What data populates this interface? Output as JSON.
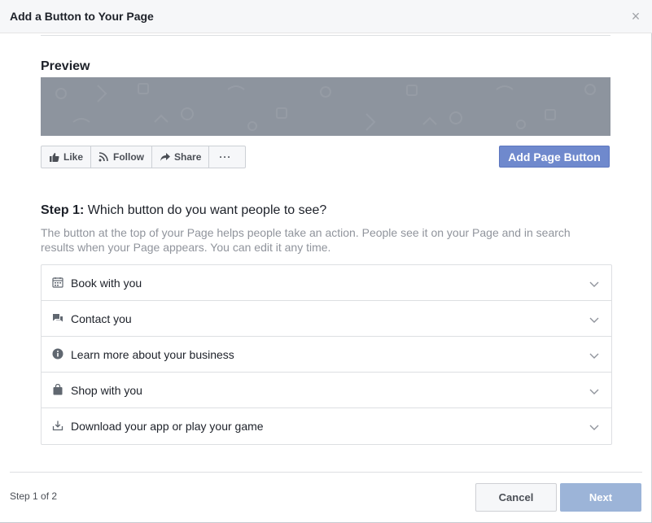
{
  "dialog": {
    "title": "Add a Button to Your Page",
    "close_glyph": "×"
  },
  "preview": {
    "title": "Preview",
    "cover_color": "#8d949e",
    "actions": [
      {
        "label": "Like",
        "icon": "thumbs-up-icon"
      },
      {
        "label": "Follow",
        "icon": "rss-icon"
      },
      {
        "label": "Share",
        "icon": "share-arrow-icon"
      },
      {
        "label": "···",
        "icon": "more-icon"
      }
    ],
    "add_button_label": "Add Page Button"
  },
  "step": {
    "label": "Step 1:",
    "question": " Which button do you want people to see?",
    "description": "The button at the top of your Page helps people take an action. People see it on your Page and in search results when your Page appears. You can edit it any time."
  },
  "options": [
    {
      "label": "Book with you",
      "icon": "calendar-icon"
    },
    {
      "label": "Contact you",
      "icon": "chat-bubbles-icon"
    },
    {
      "label": "Learn more about your business",
      "icon": "info-icon"
    },
    {
      "label": "Shop with you",
      "icon": "shopping-bag-icon"
    },
    {
      "label": "Download your app or play your game",
      "icon": "download-icon"
    }
  ],
  "footer": {
    "step_indicator": "Step 1 of 2",
    "cancel_label": "Cancel",
    "next_label": "Next"
  },
  "colors": {
    "accent": "#6f89cd",
    "next_disabled": "#9cb4d8",
    "header_bg": "#f6f7f9"
  }
}
